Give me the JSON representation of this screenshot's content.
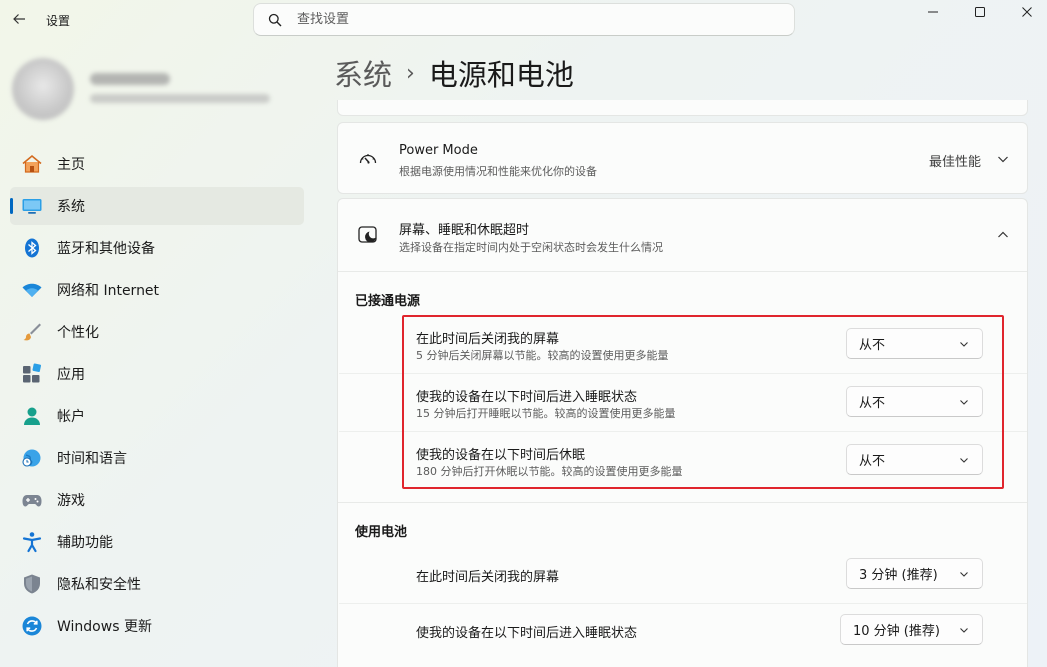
{
  "app": {
    "title": "设置"
  },
  "search": {
    "placeholder": "查找设置"
  },
  "nav": [
    {
      "id": "home",
      "label": "主页"
    },
    {
      "id": "system",
      "label": "系统"
    },
    {
      "id": "bluetooth",
      "label": "蓝牙和其他设备"
    },
    {
      "id": "network",
      "label": "网络和 Internet"
    },
    {
      "id": "personalization",
      "label": "个性化"
    },
    {
      "id": "apps",
      "label": "应用"
    },
    {
      "id": "accounts",
      "label": "帐户"
    },
    {
      "id": "time",
      "label": "时间和语言"
    },
    {
      "id": "gaming",
      "label": "游戏"
    },
    {
      "id": "accessibility",
      "label": "辅助功能"
    },
    {
      "id": "privacy",
      "label": "隐私和安全性"
    },
    {
      "id": "update",
      "label": "Windows 更新"
    }
  ],
  "breadcrumb": {
    "parent": "系统",
    "separator": "›",
    "current": "电源和电池"
  },
  "power_mode": {
    "title": "Power Mode",
    "subtitle": "根据电源使用情况和性能来优化你的设备",
    "value": "最佳性能"
  },
  "screen_sleep": {
    "title": "屏幕、睡眠和休眠超时",
    "subtitle": "选择设备在指定时间内处于空闲状态时会发生什么情况",
    "plugged_in": {
      "label": "已接通电源",
      "rows": [
        {
          "title": "在此时间后关闭我的屏幕",
          "subtitle": "5 分钟后关闭屏幕以节能。较高的设置使用更多能量",
          "value": "从不"
        },
        {
          "title": "使我的设备在以下时间后进入睡眠状态",
          "subtitle": "15 分钟后打开睡眠以节能。较高的设置使用更多能量",
          "value": "从不"
        },
        {
          "title": "使我的设备在以下时间后休眠",
          "subtitle": "180 分钟后打开休眠以节能。较高的设置使用更多能量",
          "value": "从不"
        }
      ]
    },
    "on_battery": {
      "label": "使用电池",
      "rows": [
        {
          "title": "在此时间后关闭我的屏幕",
          "value": "3 分钟 (推荐)"
        },
        {
          "title": "使我的设备在以下时间后进入睡眠状态",
          "value": "10 分钟 (推荐)"
        }
      ]
    }
  },
  "colors": {
    "accent": "#0067c0",
    "highlight": "#e0252d"
  }
}
